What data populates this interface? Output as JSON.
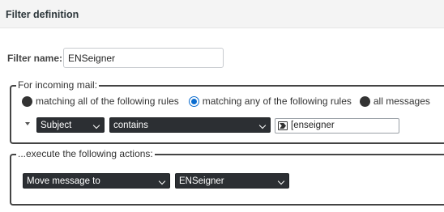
{
  "header": {
    "title": "Filter definition"
  },
  "filter": {
    "name_label": "Filter name:",
    "name_value": "ENSeigner"
  },
  "incoming": {
    "legend": "For incoming mail:",
    "radios": [
      {
        "label": "matching all of the following rules",
        "selected": false
      },
      {
        "label": "matching any of the following rules",
        "selected": true
      },
      {
        "label": "all messages",
        "selected": false
      }
    ],
    "rule": {
      "header": "Subject",
      "operator": "contains",
      "value": "[enseigner"
    }
  },
  "actions": {
    "legend": "...execute the following actions:",
    "action": "Move message to",
    "folder": "ENSeigner"
  }
}
